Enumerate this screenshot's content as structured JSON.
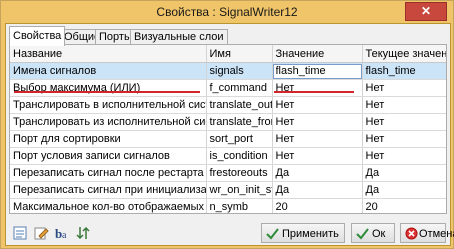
{
  "window": {
    "title": "Свойства : SignalWriter12",
    "close_label": "✕"
  },
  "tabs": [
    {
      "label": "Свойства",
      "active": true
    },
    {
      "label": "Общие",
      "active": false
    },
    {
      "label": "Порты",
      "active": false
    },
    {
      "label": "Визуальные слои",
      "active": false
    }
  ],
  "grid": {
    "columns": [
      "Название",
      "Имя",
      "Значение",
      "Текущее значение"
    ],
    "rows": [
      {
        "name": "Имена сигналов",
        "id": "signals",
        "value": "flash_time",
        "current": "flash_time"
      },
      {
        "name": "Выбор максимума (ИЛИ)",
        "id": "f_command",
        "value": "Нет",
        "current": "Нет"
      },
      {
        "name": "Транслировать в исполнительной системе",
        "id": "translate_out",
        "value": "Нет",
        "current": "Нет"
      },
      {
        "name": "Транслировать из исполнительной системы",
        "id": "translate_from_",
        "value": "Нет",
        "current": "Нет"
      },
      {
        "name": "Порт для сортировки",
        "id": "sort_port",
        "value": "Нет",
        "current": "Нет"
      },
      {
        "name": "Порт условия записи сигналов",
        "id": "is_condition",
        "value": "Нет",
        "current": "Нет"
      },
      {
        "name": "Перезаписать сигнал после рестарта",
        "id": "frestoreouts",
        "value": "Да",
        "current": "Да"
      },
      {
        "name": "Перезаписать сигнал при инициализации",
        "id": "wr_on_init_state",
        "value": "Да",
        "current": "Да"
      },
      {
        "name": "Максимальное кол-во отображаемых символов",
        "id": "n_symb",
        "value": "20",
        "current": "20"
      }
    ]
  },
  "toolbar_icons": [
    "properties-icon",
    "edit-icon",
    "font-icon",
    "sort-icon"
  ],
  "buttons": {
    "apply": "Применить",
    "ok": "Ок",
    "cancel": "Отмена"
  },
  "colors": {
    "title_bar": "#f0c468",
    "close": "#c9483e",
    "selection": "#cce4f7",
    "annotation": "#d3242a"
  }
}
